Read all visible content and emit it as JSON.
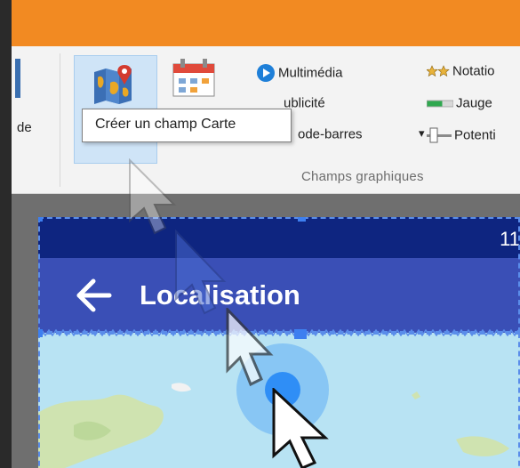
{
  "ribbon": {
    "cut_label": "de",
    "items": [
      {
        "label": "Multimédia",
        "icon": "play-circle-icon"
      },
      {
        "label": "ublicité",
        "icon": "ad-icon"
      },
      {
        "label": "ode-barres",
        "icon": "barcode-icon"
      },
      {
        "label": "Notatio",
        "icon": "stars-icon"
      },
      {
        "label": "Jauge",
        "icon": "gauge-icon"
      },
      {
        "label": "Potenti",
        "icon": "potentiometer-icon"
      }
    ],
    "dropdown_arrow": "▾",
    "group_label": "Champs graphiques"
  },
  "tooltip": {
    "text": "Créer un champ Carte"
  },
  "phone": {
    "status_time": "11",
    "title": "Localisation"
  },
  "colors": {
    "titlebar": "#f28a22",
    "status_bar": "#0e2580",
    "app_bar": "#3a4fb6",
    "ribbon_hover": "#cfe4f7",
    "map_water": "#b8e3f3",
    "map_land": "#cfe3b0",
    "location_marker": "#2f8ef6"
  }
}
